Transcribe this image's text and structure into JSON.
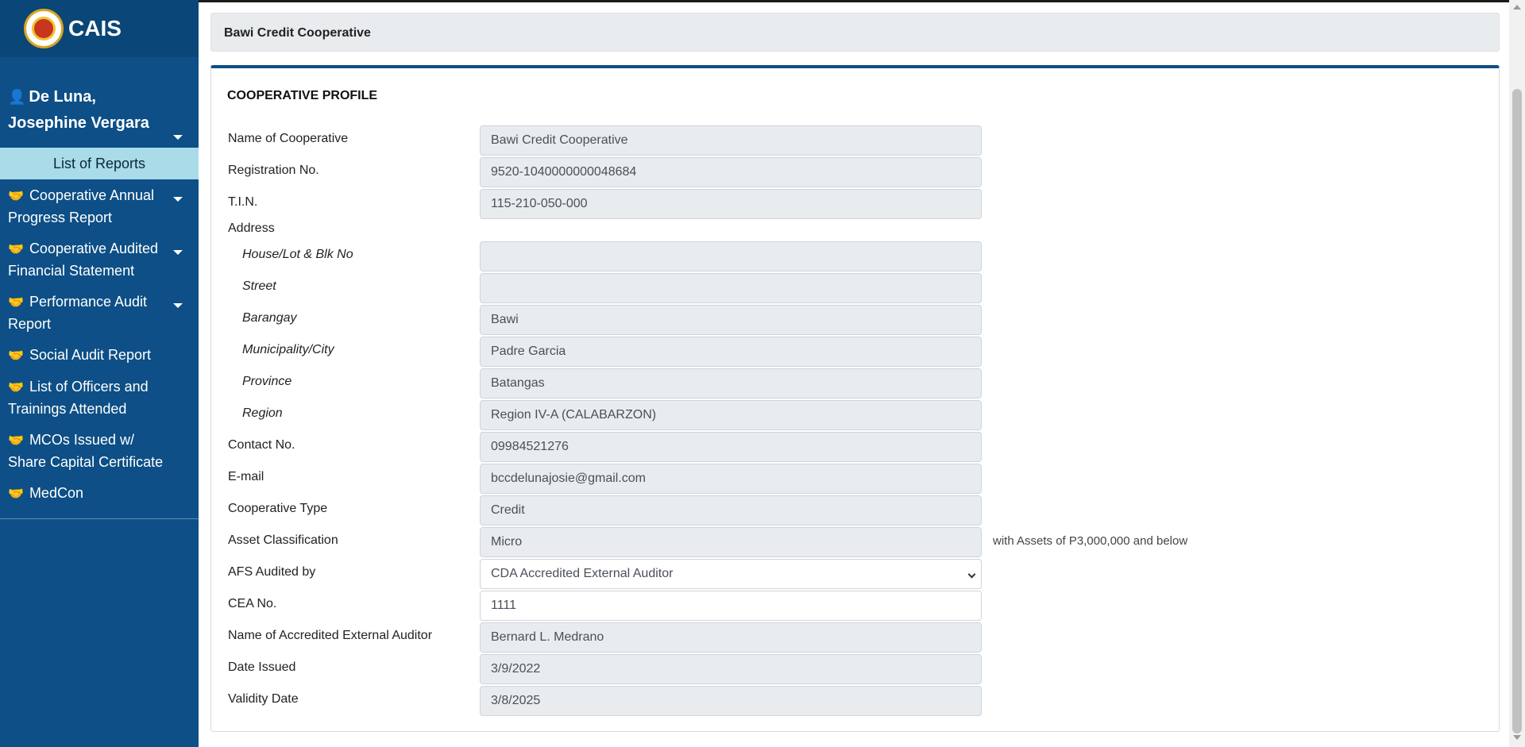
{
  "brand": {
    "title": "CAIS"
  },
  "user": {
    "name": "De Luna, Josephine Vergara"
  },
  "sidebar": {
    "section_label": "List of Reports",
    "items": [
      {
        "label": "Cooperative Annual Progress Report",
        "has_dropdown": true
      },
      {
        "label": "Cooperative Audited Financial Statement",
        "has_dropdown": true
      },
      {
        "label": "Performance Audit Report",
        "has_dropdown": true
      },
      {
        "label": "Social Audit Report",
        "has_dropdown": false
      },
      {
        "label": "List of Officers and Trainings Attended",
        "has_dropdown": false
      },
      {
        "label": "MCOs Issued w/ Share Capital Certificate",
        "has_dropdown": false
      },
      {
        "label": "MedCon",
        "has_dropdown": false
      }
    ]
  },
  "header": {
    "title": "Bawi Credit Cooperative"
  },
  "profile": {
    "section_title": "COOPERATIVE PROFILE",
    "name_label": "Name of Cooperative",
    "name_value": "Bawi Credit Cooperative",
    "reg_label": "Registration No.",
    "reg_value": "9520-1040000000048684",
    "tin_label": "T.I.N.",
    "tin_value": "115-210-050-000",
    "address_label": "Address",
    "house_label": "House/Lot & Blk No",
    "house_value": "",
    "street_label": "Street",
    "street_value": "",
    "barangay_label": "Barangay",
    "barangay_value": "Bawi",
    "city_label": "Municipality/City",
    "city_value": "Padre Garcia",
    "province_label": "Province",
    "province_value": "Batangas",
    "region_label": "Region",
    "region_value": "Region IV-A (CALABARZON)",
    "contact_label": "Contact No.",
    "contact_value": "09984521276",
    "email_label": "E-mail",
    "email_value": "bccdelunajosie@gmail.com",
    "type_label": "Cooperative Type",
    "type_value": "Credit",
    "asset_label": "Asset Classification",
    "asset_value": "Micro",
    "asset_note": "with Assets of P3,000,000 and below",
    "afs_label": "AFS Audited by",
    "afs_value": "CDA Accredited External Auditor",
    "cea_label": "CEA No.",
    "cea_value": "1111",
    "auditor_label": "Name of Accredited External Auditor",
    "auditor_value": "Bernard L. Medrano",
    "issued_label": "Date Issued",
    "issued_value": "3/9/2022",
    "validity_label": "Validity Date",
    "validity_value": "3/8/2025"
  }
}
